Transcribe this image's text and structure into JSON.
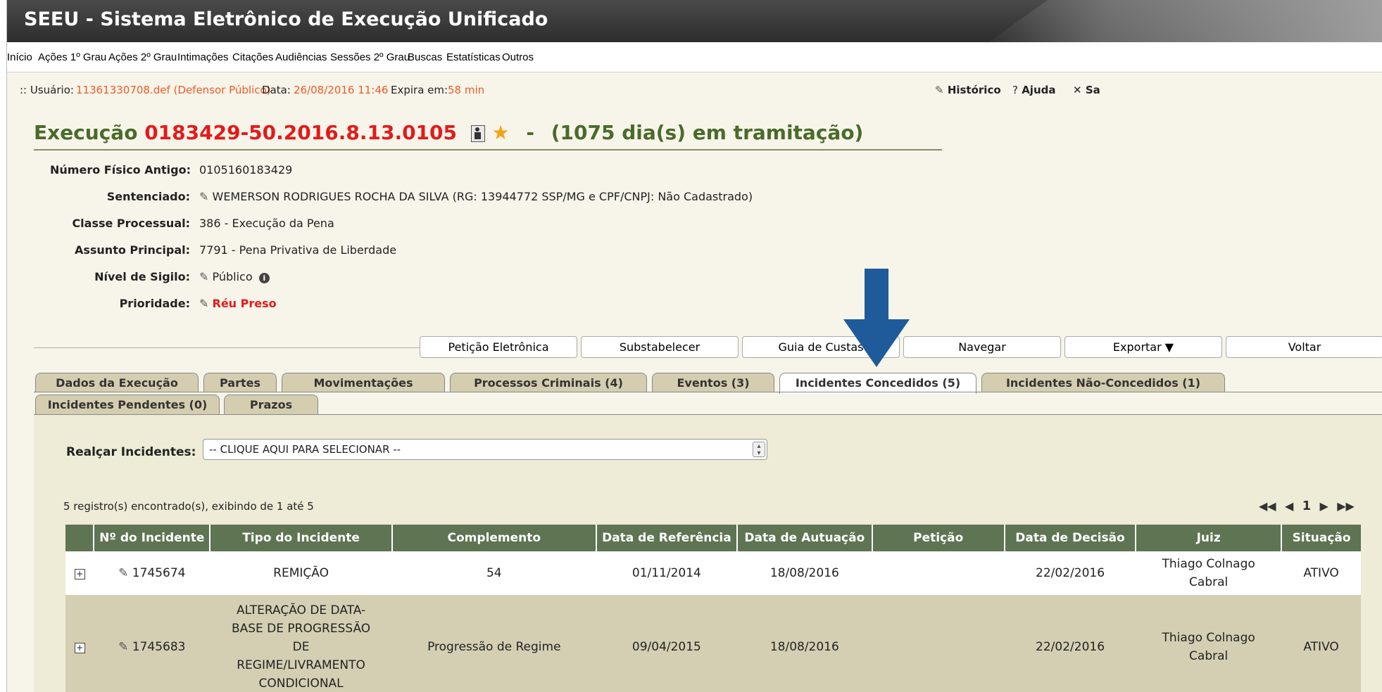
{
  "app": {
    "title": "SEEU - Sistema Eletrônico de Execução Unificado"
  },
  "menu": [
    "Início",
    "Ações 1º Grau",
    "Ações 2º Grau",
    "Intimações",
    "Citações",
    "Audiências",
    "Sessões 2º Grau",
    "Buscas",
    "Estatísticas",
    "Outros"
  ],
  "userline": {
    "prefix": ":: Usuário:",
    "user": "11361330708.def (Defensor Público)",
    "data_label": "Data:",
    "data_value": "26/08/2016 11:46",
    "expira_label": "Expira em:",
    "expira_value": "58 min"
  },
  "header_links": {
    "historico": "Histórico",
    "ajuda": "Ajuda",
    "sair": "Sa"
  },
  "heading": {
    "prefix": "Execução",
    "numero": "0183429-50.2016.8.13.0105",
    "sep": "-",
    "tramitacao": "(1075 dia(s) em tramitação)"
  },
  "details": {
    "numero_fisico_label": "Número Físico Antigo:",
    "numero_fisico_value": "0105160183429",
    "sentenciado_label": "Sentenciado:",
    "sentenciado_value": "WEMERSON RODRIGUES ROCHA DA SILVA (RG: 13944772 SSP/MG e CPF/CNPJ: Não Cadastrado)",
    "classe_label": "Classe Processual:",
    "classe_value": "386 - Execução da Pena",
    "assunto_label": "Assunto Principal:",
    "assunto_value": "7791 - Pena Privativa de Liberdade",
    "sigilo_label": "Nível de Sigilo:",
    "sigilo_value": "Público",
    "prioridade_label": "Prioridade:",
    "prioridade_value": "Réu Preso"
  },
  "actions": [
    "Petição Eletrônica",
    "Substabelecer",
    "Guia de Custas",
    "Navegar",
    "Exportar ▼",
    "Voltar"
  ],
  "tabs_row1": [
    "Dados da Execução",
    "Partes",
    "Movimentações",
    "Processos Criminais (4)",
    "Eventos (3)",
    "Incidentes Concedidos (5)",
    "Incidentes Não-Concedidos (1)"
  ],
  "tabs_row2": [
    "Incidentes Pendentes (0)",
    "Prazos"
  ],
  "realcar": {
    "label": "Realçar Incidentes:",
    "selected": "-- CLIQUE AQUI PARA SELECIONAR --"
  },
  "registros": "5 registro(s) encontrado(s), exibindo de 1 até 5",
  "pager": {
    "first": "◀◀",
    "prev": "◀",
    "page": "1",
    "next": "▶",
    "last": "▶▶"
  },
  "table": {
    "headers": [
      "",
      "Nº do Incidente",
      "Tipo do Incidente",
      "Complemento",
      "Data de Referência",
      "Data de Autuação",
      "Petição",
      "Data de Decisão",
      "Juiz",
      "Situação"
    ],
    "rows": [
      {
        "numero": "1745674",
        "tipo": "REMIÇÃO",
        "complemento": "54",
        "data_ref": "01/11/2014",
        "data_aut": "18/08/2016",
        "peticao": "",
        "data_dec": "22/02/2016",
        "juiz": "Thiago Colnago Cabral",
        "situacao": "ATIVO"
      },
      {
        "numero": "1745683",
        "tipo": "ALTERAÇÃO DE DATA-BASE DE PROGRESSÃO DE REGIME/LIVRAMENTO CONDICIONAL",
        "complemento": "Progressão de Regime",
        "data_ref": "09/04/2015",
        "data_aut": "18/08/2016",
        "peticao": "",
        "data_dec": "22/02/2016",
        "juiz": "Thiago Colnago Cabral",
        "situacao": "ATIVO"
      }
    ]
  },
  "colors": {
    "accent_orange": "#f05a28",
    "heading_green": "#4a6b2a",
    "numero_red": "#e41a1a",
    "table_header": "#5e7452",
    "arrow_blue": "#1f5b9a"
  }
}
